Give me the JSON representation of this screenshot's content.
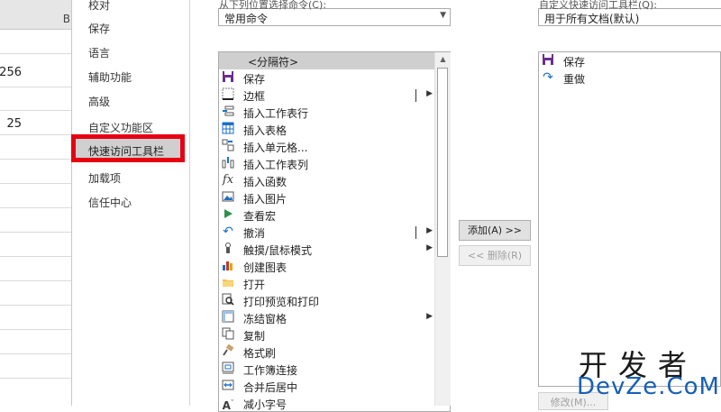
{
  "sheet": {
    "column_header": "B",
    "cells": [
      "256",
      "25"
    ]
  },
  "categories": {
    "items": [
      "校对",
      "保存",
      "语言",
      "辅助功能",
      "高级",
      "自定义功能区",
      "快速访问工具栏",
      "加载项",
      "信任中心"
    ],
    "selected_index": 6
  },
  "choose_commands": {
    "label": "从下列位置选择命令(C):",
    "value": "常用命令"
  },
  "customize_qat": {
    "label": "自定义快速访问工具栏(Q):",
    "value": "用于所有文档(默认)"
  },
  "commands": [
    {
      "label": "<分隔符>",
      "icon": "separator",
      "submenu": false,
      "selected": true
    },
    {
      "label": "保存",
      "icon": "save-icon",
      "submenu": false
    },
    {
      "label": "边框",
      "icon": "borders-icon",
      "submenu": true
    },
    {
      "label": "插入工作表行",
      "icon": "insert-row-icon",
      "submenu": false
    },
    {
      "label": "插入表格",
      "icon": "insert-table-icon",
      "submenu": false
    },
    {
      "label": "插入单元格...",
      "icon": "insert-cells-icon",
      "submenu": false
    },
    {
      "label": "插入工作表列",
      "icon": "insert-column-icon",
      "submenu": false
    },
    {
      "label": "插入函数",
      "icon": "function-icon",
      "submenu": false
    },
    {
      "label": "插入图片",
      "icon": "picture-icon",
      "submenu": false
    },
    {
      "label": "查看宏",
      "icon": "macro-play-icon",
      "submenu": false
    },
    {
      "label": "撤消",
      "icon": "undo-icon",
      "submenu": true
    },
    {
      "label": "触摸/鼠标模式",
      "icon": "touch-icon",
      "submenu": true
    },
    {
      "label": "创建图表",
      "icon": "chart-icon",
      "submenu": false
    },
    {
      "label": "打开",
      "icon": "folder-icon",
      "submenu": false
    },
    {
      "label": "打印预览和打印",
      "icon": "print-preview-icon",
      "submenu": false
    },
    {
      "label": "冻结窗格",
      "icon": "freeze-panes-icon",
      "submenu": true
    },
    {
      "label": "复制",
      "icon": "copy-icon",
      "submenu": false
    },
    {
      "label": "格式刷",
      "icon": "format-painter-icon",
      "submenu": false
    },
    {
      "label": "工作簿连接",
      "icon": "connections-icon",
      "submenu": false
    },
    {
      "label": "合并后居中",
      "icon": "merge-center-icon",
      "submenu": false
    },
    {
      "label": "减小字号",
      "icon": "decrease-font-icon",
      "submenu": false
    }
  ],
  "buttons": {
    "add": "添加(A) >>",
    "remove": "<< 删除(R)",
    "modify": "修改(M)..."
  },
  "qat_items": [
    {
      "label": "保存",
      "icon": "save-icon"
    },
    {
      "label": "重做",
      "icon": "redo-icon"
    }
  ],
  "watermark": {
    "line1": "开发者",
    "line2": "DevZe.CoM"
  },
  "colors": {
    "highlight_box": "#e60012",
    "selected_bg": "#cfcfcf",
    "save_icon": "#6b2e8f",
    "watermark_blue": "#1860b5"
  }
}
